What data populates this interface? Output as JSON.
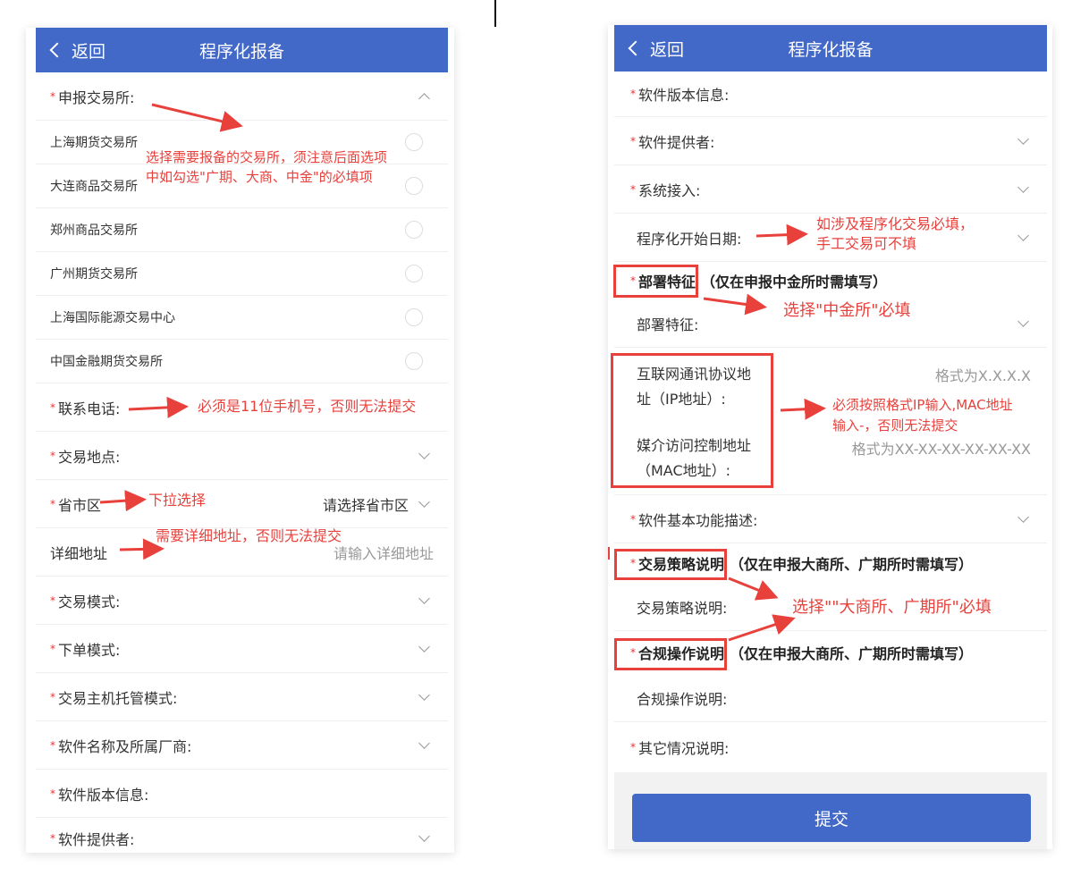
{
  "left": {
    "header": {
      "back": "返回",
      "title": "程序化报备"
    },
    "exchange_label": "申报交易所:",
    "exchanges": [
      "上海期货交易所",
      "大连商品交易所",
      "郑州商品交易所",
      "广州期货交易所",
      "上海国际能源交易中心",
      "中国金融期货交易所"
    ],
    "phone_label": "联系电话:",
    "location_label": "交易地点:",
    "region_label": "省市区",
    "region_placeholder": "请选择省市区",
    "address_label": "详细地址",
    "address_placeholder": "请输入详细地址",
    "trade_mode_label": "交易模式:",
    "order_mode_label": "下单模式:",
    "host_label": "交易主机托管模式:",
    "software_name_label": "软件名称及所属厂商:",
    "software_version_label": "软件版本信息:",
    "software_provider_label": "软件提供者:"
  },
  "right": {
    "header": {
      "back": "返回",
      "title": "程序化报备"
    },
    "software_version_label": "软件版本信息:",
    "software_provider_label": "软件提供者:",
    "system_access_label": "系统接入:",
    "start_date_label": "程序化开始日期:",
    "deploy_title": "部署特征",
    "deploy_note": "（仅在申报中金所时需填写）",
    "deploy_label": "部署特征:",
    "ip_label": "互联网通讯协议地址（IP地址）:",
    "ip_placeholder": "格式为X.X.X.X",
    "mac_label": "媒介访问控制地址（MAC地址）:",
    "mac_placeholder": "格式为XX-XX-XX-XX-XX-XX",
    "function_label": "软件基本功能描述:",
    "strategy_title": "交易策略说明",
    "strategy_note": "（仅在申报大商所、广期所时需填写）",
    "strategy_label": "交易策略说明:",
    "compliance_title": "合规操作说明",
    "compliance_note": "（仅在申报大商所、广期所时需填写）",
    "compliance_label": "合规操作说明:",
    "other_label": "其它情况说明:",
    "submit": "提交"
  },
  "annotations": {
    "exchange_note_1": "选择需要报备的交易所，须注意后面选项",
    "exchange_note_2": "中如勾选\"广期、大商、中金\"的必填项",
    "phone_note": "必须是11位手机号，否则无法提交",
    "region_note": "下拉选择",
    "address_note": "需要详细地址，否则无法提交",
    "start_date_note_1": "如涉及程序化交易必填，",
    "start_date_note_2": "手工交易可不填",
    "deploy_note": "选择\"中金所\"必填",
    "ip_mac_note_1": "必须按照格式IP输入,MAC地址",
    "ip_mac_note_2": "输入-，否则无法提交",
    "strategy_note": "选择\"\"大商所、广期所\"必填"
  },
  "colors": {
    "header": "#4268c8",
    "annotation": "#e8413c",
    "required": "#e33"
  }
}
